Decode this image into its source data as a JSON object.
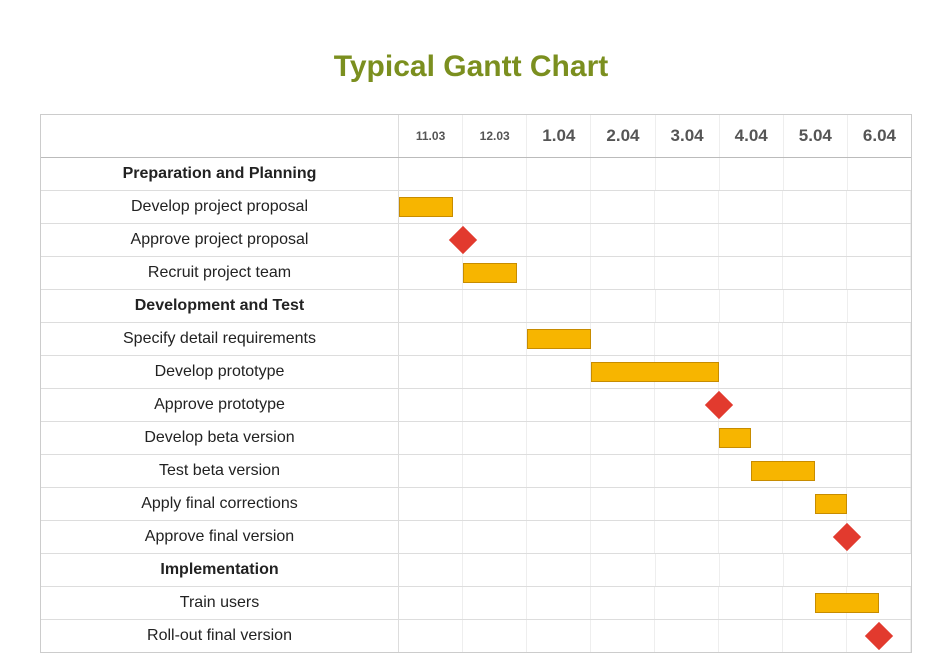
{
  "title": "Typical Gantt Chart",
  "chart_data": {
    "type": "gantt",
    "time_unit": "month",
    "columns": [
      {
        "label": "11.03",
        "style": "minor"
      },
      {
        "label": "12.03",
        "style": "minor"
      },
      {
        "label": "1.04",
        "style": "major"
      },
      {
        "label": "2.04",
        "style": "major"
      },
      {
        "label": "3.04",
        "style": "major"
      },
      {
        "label": "4.04",
        "style": "major"
      },
      {
        "label": "5.04",
        "style": "major"
      },
      {
        "label": "6.04",
        "style": "major"
      }
    ],
    "rows": [
      {
        "kind": "group",
        "label": "Preparation and Planning"
      },
      {
        "kind": "task",
        "label": "Develop project proposal",
        "bar": {
          "start_col": 0.0,
          "span": 0.85
        }
      },
      {
        "kind": "task",
        "label": "Approve project proposal",
        "milestone": {
          "at_col": 1.0
        }
      },
      {
        "kind": "task",
        "label": "Recruit project team",
        "bar": {
          "start_col": 1.0,
          "span": 0.85
        }
      },
      {
        "kind": "group",
        "label": "Development and Test"
      },
      {
        "kind": "task",
        "label": "Specify detail requirements",
        "bar": {
          "start_col": 2.0,
          "span": 1.0
        }
      },
      {
        "kind": "task",
        "label": "Develop prototype",
        "bar": {
          "start_col": 3.0,
          "span": 2.0
        }
      },
      {
        "kind": "task",
        "label": "Approve prototype",
        "milestone": {
          "at_col": 5.0
        }
      },
      {
        "kind": "task",
        "label": "Develop beta version",
        "bar": {
          "start_col": 5.0,
          "span": 0.5
        }
      },
      {
        "kind": "task",
        "label": "Test beta version",
        "bar": {
          "start_col": 5.5,
          "span": 1.0
        }
      },
      {
        "kind": "task",
        "label": "Apply final corrections",
        "bar": {
          "start_col": 6.5,
          "span": 0.5
        }
      },
      {
        "kind": "task",
        "label": "Approve final version",
        "milestone": {
          "at_col": 7.0
        }
      },
      {
        "kind": "group",
        "label": "Implementation"
      },
      {
        "kind": "task",
        "label": "Train users",
        "bar": {
          "start_col": 6.5,
          "span": 1.0
        }
      },
      {
        "kind": "task",
        "label": "Roll-out final version",
        "milestone": {
          "at_col": 7.5
        }
      }
    ],
    "colors": {
      "bar_fill": "#f7b500",
      "bar_border": "#c78c00",
      "milestone": "#e23a2e",
      "title": "#7b8f1f"
    }
  }
}
